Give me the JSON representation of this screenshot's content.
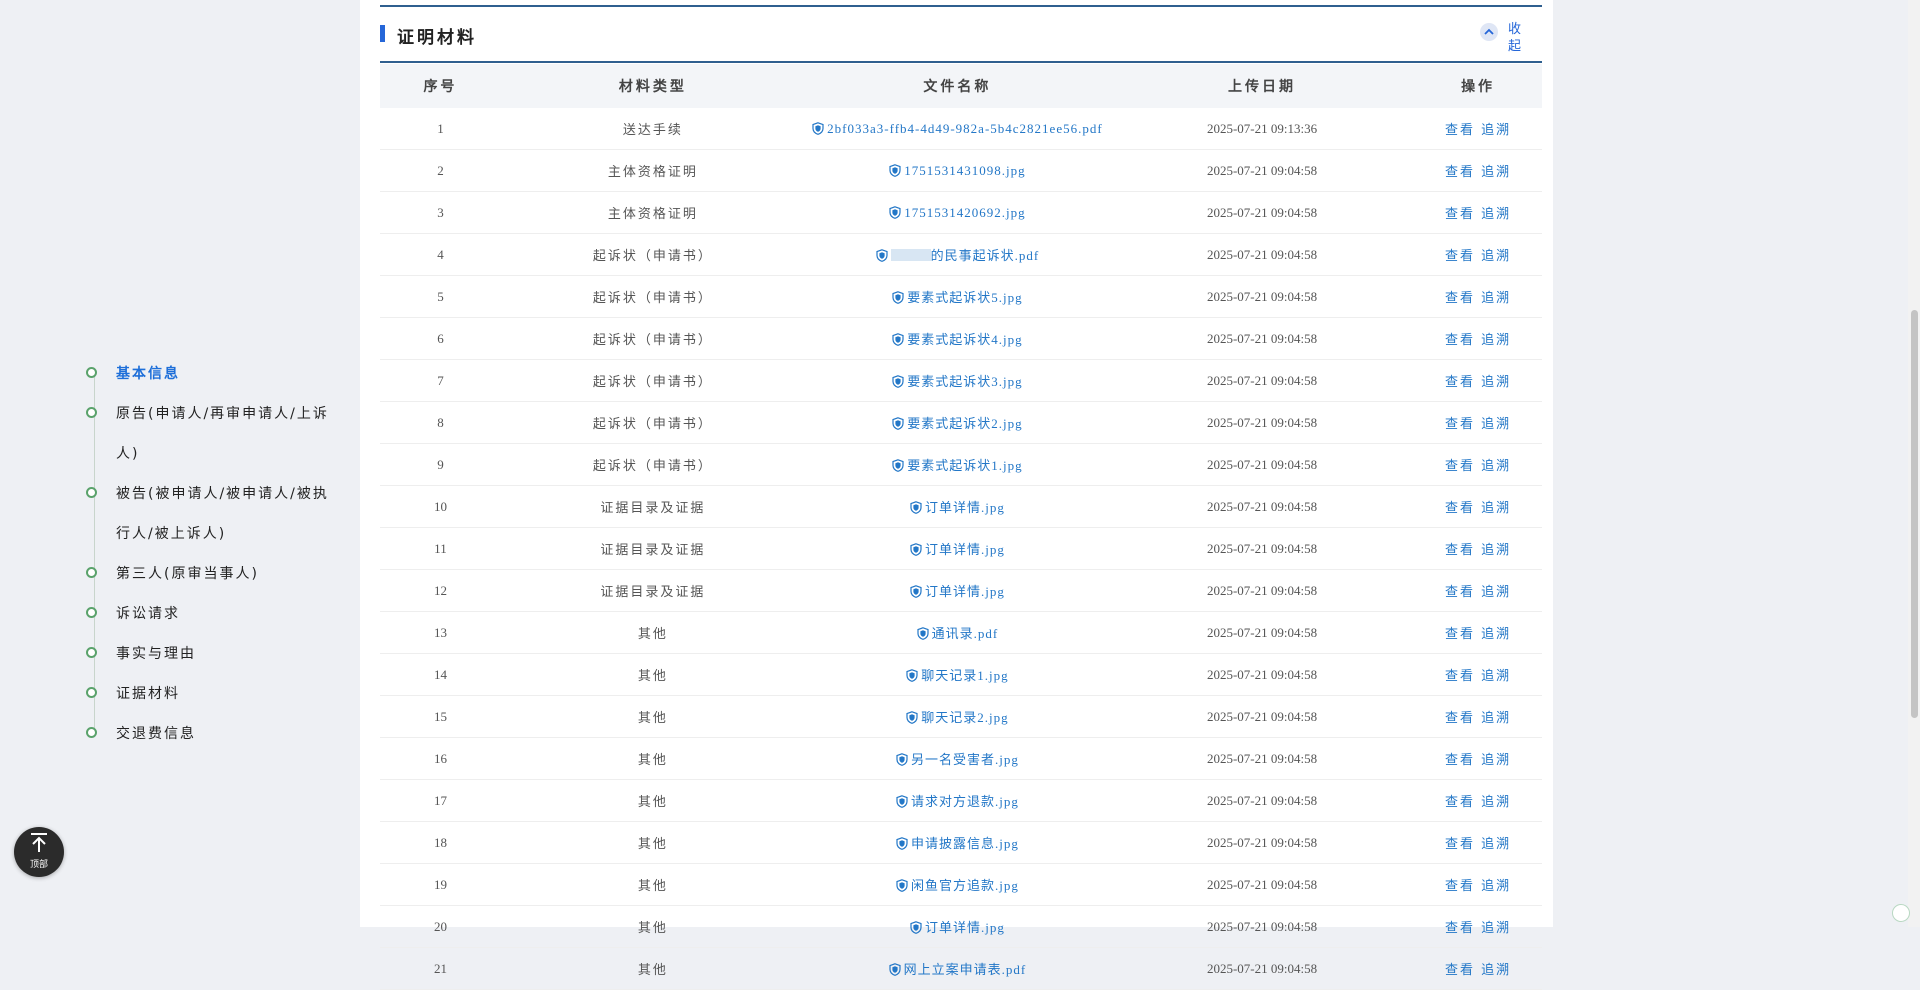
{
  "nav": {
    "items": [
      {
        "label": "基本信息",
        "active": true
      },
      {
        "label": "原告(申请人/再审申请人/上诉人)"
      },
      {
        "label": "被告(被申请人/被申请人/被执行人/被上诉人)"
      },
      {
        "label": "第三人(原审当事人)"
      },
      {
        "label": "诉讼请求"
      },
      {
        "label": "事实与理由"
      },
      {
        "label": "证据材料"
      },
      {
        "label": "交退费信息"
      }
    ]
  },
  "back_top": {
    "label": "顶部"
  },
  "section": {
    "title": "证明材料",
    "collapse_label": "收起"
  },
  "table": {
    "headers": [
      "序号",
      "材料类型",
      "文件名称",
      "上传日期",
      "操作"
    ],
    "actions": {
      "view": "查看",
      "trace": "追溯"
    },
    "rows": [
      {
        "no": "1",
        "type": "送达手续",
        "file": "2bf033a3-ffb4-4d49-982a-5b4c2821ee56.pdf",
        "date": "2025-07-21 09:13:36"
      },
      {
        "no": "2",
        "type": "主体资格证明",
        "file": "1751531431098.jpg",
        "date": "2025-07-21 09:04:58"
      },
      {
        "no": "3",
        "type": "主体资格证明",
        "file": "1751531420692.jpg",
        "date": "2025-07-21 09:04:58"
      },
      {
        "no": "4",
        "type": "起诉状（申请书）",
        "file": "的民事起诉状.pdf",
        "date": "2025-07-21 09:04:58",
        "redacted": true
      },
      {
        "no": "5",
        "type": "起诉状（申请书）",
        "file": "要素式起诉状5.jpg",
        "date": "2025-07-21 09:04:58"
      },
      {
        "no": "6",
        "type": "起诉状（申请书）",
        "file": "要素式起诉状4.jpg",
        "date": "2025-07-21 09:04:58"
      },
      {
        "no": "7",
        "type": "起诉状（申请书）",
        "file": "要素式起诉状3.jpg",
        "date": "2025-07-21 09:04:58"
      },
      {
        "no": "8",
        "type": "起诉状（申请书）",
        "file": "要素式起诉状2.jpg",
        "date": "2025-07-21 09:04:58"
      },
      {
        "no": "9",
        "type": "起诉状（申请书）",
        "file": "要素式起诉状1.jpg",
        "date": "2025-07-21 09:04:58"
      },
      {
        "no": "10",
        "type": "证据目录及证据",
        "file": "订单详情.jpg",
        "date": "2025-07-21 09:04:58"
      },
      {
        "no": "11",
        "type": "证据目录及证据",
        "file": "订单详情.jpg",
        "date": "2025-07-21 09:04:58"
      },
      {
        "no": "12",
        "type": "证据目录及证据",
        "file": "订单详情.jpg",
        "date": "2025-07-21 09:04:58"
      },
      {
        "no": "13",
        "type": "其他",
        "file": "通讯录.pdf",
        "date": "2025-07-21 09:04:58"
      },
      {
        "no": "14",
        "type": "其他",
        "file": "聊天记录1.jpg",
        "date": "2025-07-21 09:04:58"
      },
      {
        "no": "15",
        "type": "其他",
        "file": "聊天记录2.jpg",
        "date": "2025-07-21 09:04:58"
      },
      {
        "no": "16",
        "type": "其他",
        "file": "另一名受害者.jpg",
        "date": "2025-07-21 09:04:58"
      },
      {
        "no": "17",
        "type": "其他",
        "file": "请求对方退款.jpg",
        "date": "2025-07-21 09:04:58"
      },
      {
        "no": "18",
        "type": "其他",
        "file": "申请披露信息.jpg",
        "date": "2025-07-21 09:04:58"
      },
      {
        "no": "19",
        "type": "其他",
        "file": "闲鱼官方追款.jpg",
        "date": "2025-07-21 09:04:58"
      },
      {
        "no": "20",
        "type": "其他",
        "file": "订单详情.jpg",
        "date": "2025-07-21 09:04:58"
      },
      {
        "no": "21",
        "type": "其他",
        "file": "网上立案申请表.pdf",
        "date": "2025-07-21 09:04:58"
      }
    ]
  },
  "colors": {
    "accent": "#2566d8",
    "link": "#2377c7",
    "nav_dot": "#5aa26b",
    "header_line": "#2f5f8f"
  },
  "icons": {
    "file": "shield-icon",
    "collapse": "chevron-up-icon",
    "back_top": "arrow-up-icon"
  }
}
